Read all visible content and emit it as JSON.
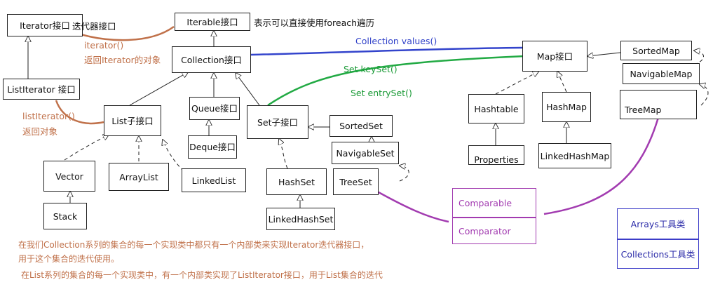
{
  "boxes": {
    "iterator": "Iterator接口",
    "iterable": "Iterable接口",
    "collection": "Collection接口",
    "listiterator": "ListIterator 接口",
    "list": "List子接口",
    "queue": "Queue接口",
    "deque": "Deque接口",
    "set": "Set子接口",
    "sortedset": "SortedSet",
    "navigableset": "NavigableSet",
    "vector": "Vector",
    "arraylist": "ArrayList",
    "linkedlist": "LinkedList",
    "stack": "Stack",
    "hashset": "HashSet",
    "treeset": "TreeSet",
    "linkedhashset": "LinkedHashSet",
    "map": "Map接口",
    "sortedmap": "SortedMap",
    "navigablemap": "NavigableMap",
    "hashtable": "Hashtable",
    "hashmap": "HashMap",
    "treemap": "TreeMap",
    "properties": "Properties",
    "linkedhashmap": "LinkedHashMap",
    "comparable": "Comparable",
    "comparator": "Comparator",
    "arrays": "Arrays工具类",
    "collections": "Collections工具类"
  },
  "labels": {
    "iterator_desc": "迭代器接口",
    "iterable_desc": "表示可以直接使用foreach遍历",
    "iterator_method": "iterator()",
    "iterator_return": "返回Iterator的对象",
    "listiterator_method": "listIterator()",
    "listiterator_return": "返回对象",
    "values": "Collection  values()",
    "keyset": "Set  keySet()",
    "entryset": "Set  entrySet()"
  },
  "notes": [
    "在我们Collection系列的集合的每一个实现类中都只有一个内部类来实现Iterator迭代器接口，",
    "用于这个集合的迭代使用。",
    "在List系列的集合的每一个实现类中，有一个内部类实现了ListIterator接口，用于List集合的迭代"
  ],
  "colors": {
    "brown": "#c0714a",
    "blue": "#2f40c8",
    "green": "#1a9a36",
    "purple": "#a23bb0",
    "black": "#222222"
  }
}
